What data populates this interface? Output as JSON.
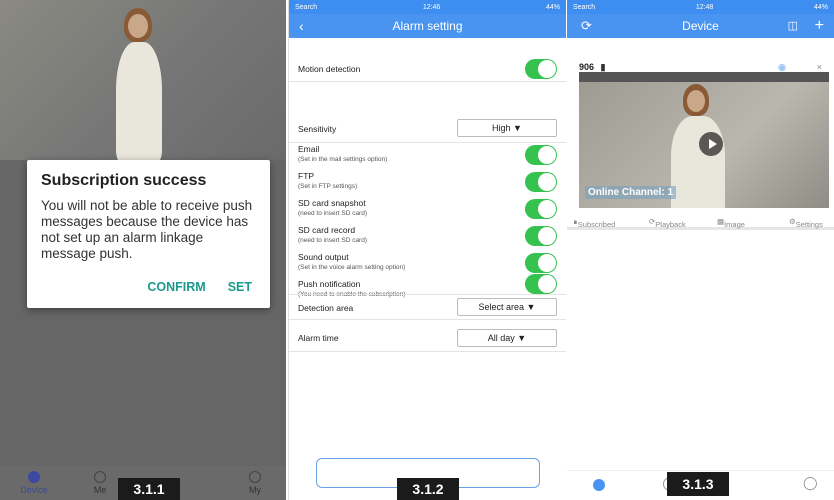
{
  "panel1": {
    "dialog": {
      "title": "Subscription success",
      "message": "You will not be able to receive push messages because the device has not set up an alarm linkage message push.",
      "confirm": "CONFIRM",
      "set": "SET"
    },
    "tabs": [
      "Device",
      "Me",
      "My"
    ],
    "label": "3.1.1"
  },
  "panel2": {
    "status": {
      "left": "Search",
      "time": "12:46",
      "battery": "44%"
    },
    "title": "Alarm setting",
    "rows": [
      {
        "label": "Motion detection",
        "sub": ""
      },
      {
        "label": "Sensitivity",
        "sub": "",
        "value": "High"
      },
      {
        "label": "Email",
        "sub": "(Set in the mail settings option)"
      },
      {
        "label": "FTP",
        "sub": "(Set in FTP settings)"
      },
      {
        "label": "SD card snapshot",
        "sub": "(need to insert SD card)"
      },
      {
        "label": "SD card record",
        "sub": "(need to insert SD card)"
      },
      {
        "label": "Sound output",
        "sub": "(Set in the voice alarm setting option)"
      },
      {
        "label": "Push notification",
        "sub": "(You need to enable the subscription)"
      },
      {
        "label": "Detection area",
        "sub": "",
        "value": "Select area"
      },
      {
        "label": "Alarm time",
        "sub": "",
        "value": "All day"
      }
    ],
    "label": "3.1.2"
  },
  "panel3": {
    "status": {
      "left": "Search",
      "time": "12:48",
      "battery": "44%"
    },
    "title": "Device",
    "device_name": "906",
    "online": "Online Channel: 1",
    "tabs": [
      "Subscribed",
      "Playback",
      "Image",
      "Settings"
    ],
    "label": "3.1.3"
  },
  "colors": {
    "accent": "#4a94f1",
    "toggle": "#35c24e",
    "dialog_button": "#1a9a8c"
  }
}
